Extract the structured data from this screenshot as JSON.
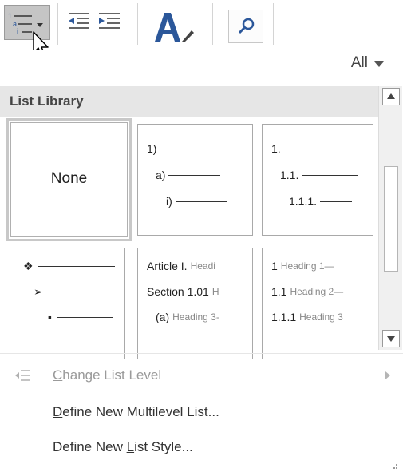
{
  "filter": {
    "label": "All"
  },
  "library": {
    "header": "List Library"
  },
  "tiles": {
    "none": {
      "label": "None"
    },
    "numbered": {
      "rows": [
        "1)",
        "a)",
        "i)"
      ]
    },
    "decimal": {
      "rows": [
        "1.",
        "1.1.",
        "1.1.1."
      ]
    },
    "bullets": {
      "rows": [
        "❖",
        "➢",
        "▪"
      ]
    },
    "article": {
      "rows": [
        {
          "prefix": "Article I.",
          "suffix": "Headi"
        },
        {
          "prefix": "Section 1.01",
          "suffix": "H"
        },
        {
          "prefix": "(a)",
          "suffix": "Heading 3-"
        }
      ]
    },
    "heading": {
      "rows": [
        {
          "prefix": "1",
          "suffix": "Heading 1—"
        },
        {
          "prefix": "1.1",
          "suffix": "Heading 2—"
        },
        {
          "prefix": "1.1.1",
          "suffix": "Heading 3"
        }
      ]
    }
  },
  "menu": {
    "change_level": {
      "accel": "C",
      "rest": "hange List Level"
    },
    "define_multilevel": {
      "accel": "D",
      "rest": "efine New Multilevel List..."
    },
    "define_style": {
      "before": "Define New ",
      "accel": "L",
      "rest": "ist Style..."
    }
  }
}
